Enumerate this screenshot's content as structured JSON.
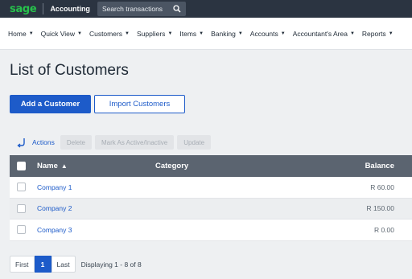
{
  "topbar": {
    "logo": "sage",
    "app_title": "Accounting",
    "search_placeholder": "Search transactions"
  },
  "nav": {
    "items": [
      "Home",
      "Quick View",
      "Customers",
      "Suppliers",
      "Items",
      "Banking",
      "Accounts",
      "Accountant's Area",
      "Reports"
    ]
  },
  "page": {
    "title": "List of Customers"
  },
  "buttons": {
    "add_customer": "Add a Customer",
    "import_customers": "Import Customers"
  },
  "actions": {
    "label": "Actions",
    "delete": "Delete",
    "mark_active": "Mark As Active/Inactive",
    "update": "Update"
  },
  "table": {
    "headers": {
      "name": "Name",
      "category": "Category",
      "balance": "Balance"
    },
    "rows": [
      {
        "name": "Company 1",
        "category": "",
        "balance": "R 60.00"
      },
      {
        "name": "Company 2",
        "category": "",
        "balance": "R 150.00"
      },
      {
        "name": "Company 3",
        "category": "",
        "balance": "R 0.00"
      }
    ]
  },
  "pagination": {
    "first": "First",
    "current": "1",
    "last": "Last",
    "info": "Displaying 1 - 8 of 8"
  },
  "colors": {
    "accent": "#1d5bc9",
    "topbar": "#2b3441",
    "header": "#5b6470",
    "brand_green": "#27c24c"
  },
  "icons": {
    "search": "search-icon",
    "actions": "actions-arrow-icon",
    "sort": "sort-ascending-icon",
    "caret": "caret-down-icon"
  }
}
